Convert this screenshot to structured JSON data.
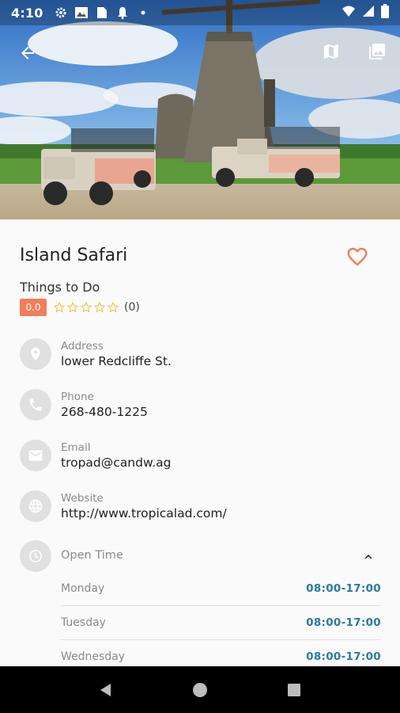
{
  "status_bar": {
    "time": "4:10",
    "left_icons": [
      "gear-icon",
      "image-icon",
      "sim-card-icon",
      "bell-icon",
      "dot-icon"
    ],
    "right_icons": [
      "wifi-icon",
      "signal-icon",
      "battery-icon"
    ]
  },
  "toolbar": {
    "back_icon": "arrow-back-icon",
    "map_icon": "map-icon",
    "gallery_icon": "gallery-icon"
  },
  "place": {
    "title": "Island Safari",
    "category": "Things to Do",
    "rating_value": "0.0",
    "rating_count": "(0)",
    "star_count": 5,
    "favorite_color": "#f37e5a"
  },
  "details": [
    {
      "icon": "location-pin-icon",
      "label": "Address",
      "value": "lower Redcliffe St."
    },
    {
      "icon": "phone-icon",
      "label": "Phone",
      "value": "268-480-1225"
    },
    {
      "icon": "email-icon",
      "label": "Email",
      "value": "tropad@candw.ag"
    },
    {
      "icon": "globe-icon",
      "label": "Website",
      "value": "http://www.tropicalad.com/"
    }
  ],
  "open_time": {
    "label": "Open Time",
    "expanded": true,
    "hours": [
      {
        "day": "Monday",
        "time": "08:00-17:00"
      },
      {
        "day": "Tuesday",
        "time": "08:00-17:00"
      },
      {
        "day": "Wednesday",
        "time": "08:00-17:00"
      }
    ]
  },
  "nav_bar": [
    "back-triangle-icon",
    "home-circle-icon",
    "recents-square-icon"
  ],
  "colors": {
    "accent": "#f37e5a",
    "time_link": "#2a7ba0",
    "icon_circle": "#e0e0e0"
  }
}
